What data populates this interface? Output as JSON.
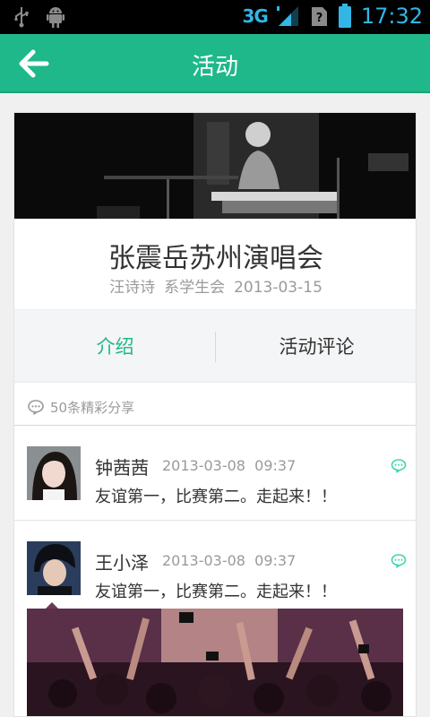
{
  "status_bar": {
    "network": "3G",
    "time": "17:32",
    "icons": [
      "usb-icon",
      "android-debug-icon",
      "signal-icon",
      "sim-icon",
      "battery-icon"
    ]
  },
  "app_bar": {
    "title": "活动",
    "back_icon": "arrow-left-icon"
  },
  "event": {
    "title": "张震岳苏州演唱会",
    "organizer": "汪诗诗",
    "department": "系学生会",
    "date": "2013-03-15"
  },
  "tabs": {
    "intro": "介绍",
    "comments": "活动评论"
  },
  "shares": {
    "count_label": "50条精彩分享"
  },
  "comments": [
    {
      "name": "钟茜茜",
      "date": "2013-03-08",
      "time": "09:37",
      "text": "友谊第一，比赛第二。走起来！！"
    },
    {
      "name": "王小泽",
      "date": "2013-03-08",
      "time": "09:37",
      "text": "友谊第一，比赛第二。走起来！！"
    }
  ],
  "colors": {
    "accent": "#1fb88a",
    "status_text": "#33b5e5",
    "reply_icon": "#3dd6b0"
  }
}
